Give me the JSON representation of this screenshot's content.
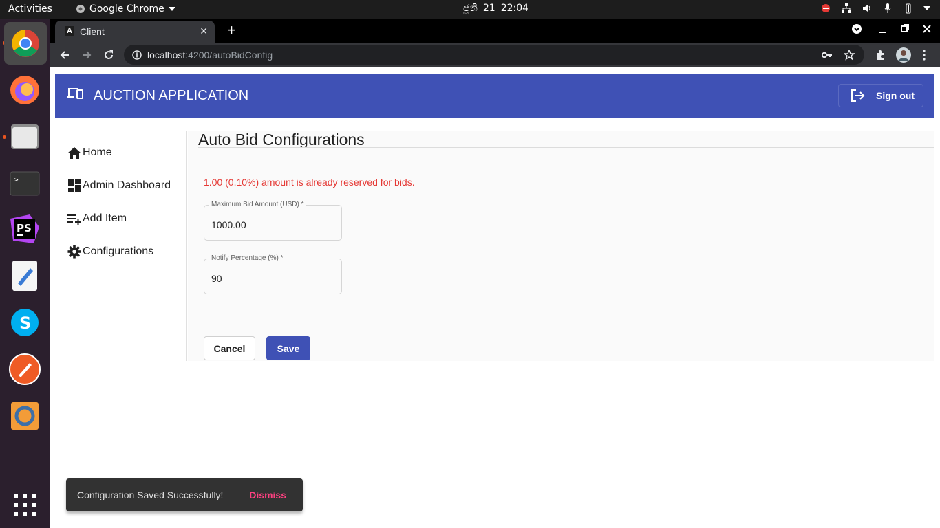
{
  "topbar": {
    "activities": "Activities",
    "app_menu": "Google Chrome",
    "date": "ජූනි",
    "day": "21",
    "time": "22:04"
  },
  "dock": {
    "items": [
      "chrome-icon",
      "firefox-icon",
      "files-icon",
      "terminal-icon",
      "phpstorm-icon",
      "text-editor-icon",
      "skype-icon",
      "postman-icon",
      "sublime-merge-icon",
      "app-grid-icon"
    ]
  },
  "browser": {
    "tab_title": "Client",
    "tab_favicon": "A",
    "url_host": "localhost",
    "url_path": ":4200/autoBidConfig"
  },
  "app": {
    "title": "AUCTION APPLICATION",
    "sign_out": "Sign out",
    "accent": "#3f51b5"
  },
  "sidenav": {
    "items": [
      {
        "label": "Home",
        "icon": "home-icon"
      },
      {
        "label": "Admin Dashboard",
        "icon": "dashboard-icon"
      },
      {
        "label": "Add Item",
        "icon": "playlist-add-icon"
      },
      {
        "label": "Configurations",
        "icon": "gear-icon"
      }
    ]
  },
  "page": {
    "heading": "Auto Bid Configurations",
    "reserved_message": "1.00 (0.10%) amount is already reserved for bids.",
    "max_bid_label": "Maximum Bid Amount (USD) *",
    "max_bid_value": "1000.00",
    "notify_label": "Notify Percentage (%) *",
    "notify_value": "90",
    "cancel": "Cancel",
    "save": "Save"
  },
  "snackbar": {
    "message": "Configuration Saved Successfully!",
    "action": "Dismiss"
  }
}
